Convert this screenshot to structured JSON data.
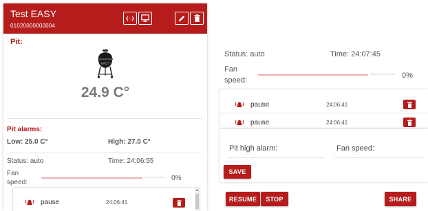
{
  "pit_card": {
    "title": "Test EASY",
    "device_id": "01020000000004",
    "pit_label": "Pit:",
    "temperature": "24.9 C°",
    "alarms_label": "Pit alarms:",
    "low_alarm": "Low: 25.0 C°",
    "high_alarm": "High: 27.0 C°",
    "status": "Status: auto",
    "time": "Time: 24:06:55",
    "fan_label_line1": "Fan",
    "fan_label_line2": "speed:",
    "fan_value": "0%",
    "events": [
      {
        "label": "pause",
        "time": "24:06:41"
      }
    ]
  },
  "detail_panel": {
    "status": "Status: auto",
    "time": "Time: 24:07:45",
    "fan_label_line1": "Fan",
    "fan_label_line2": "speed:",
    "fan_value": "0%",
    "events": [
      {
        "label": "pause",
        "time": "24:06:41"
      },
      {
        "label": "pause",
        "time": "24:06:41"
      }
    ],
    "form": {
      "pit_high_alarm_label": "Pit high alarm:",
      "fan_speed_label": "Fan speed:",
      "save_label": "SAVE"
    },
    "buttons": {
      "resume_label": "RESUME",
      "stop_label": "STOP",
      "share_label": "SHARE"
    }
  },
  "colors": {
    "accent": "#b71c1c",
    "slider_track": "#f0b0b0"
  },
  "icons": [
    "code-icon",
    "monitor-icon",
    "pencil-icon",
    "trash-icon",
    "kettle-grill-icon",
    "alarm-bell-icon"
  ]
}
